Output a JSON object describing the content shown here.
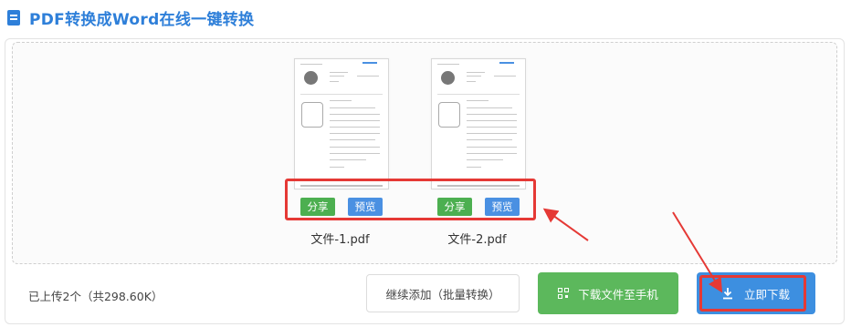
{
  "header": {
    "title": "PDF转换成Word在线一键转换"
  },
  "files": [
    {
      "name": "文件-1.pdf",
      "share_label": "分享",
      "preview_label": "预览"
    },
    {
      "name": "文件-2.pdf",
      "share_label": "分享",
      "preview_label": "预览"
    }
  ],
  "footer": {
    "uploaded_text": "已上传2个（共298.60K）",
    "continue_label": "继续添加（批量转换）",
    "phone_label": "下载文件至手机",
    "download_label": "立即下载"
  },
  "colors": {
    "accent": "#2e7fd9",
    "share": "#4caf50",
    "preview": "#4a90e2",
    "phone_button": "#5cb85c",
    "download_button": "#3d8fe0",
    "highlight": "#e53935"
  },
  "icons": {
    "header": "document-icon",
    "phone": "qr-code-icon",
    "download": "download-icon"
  }
}
